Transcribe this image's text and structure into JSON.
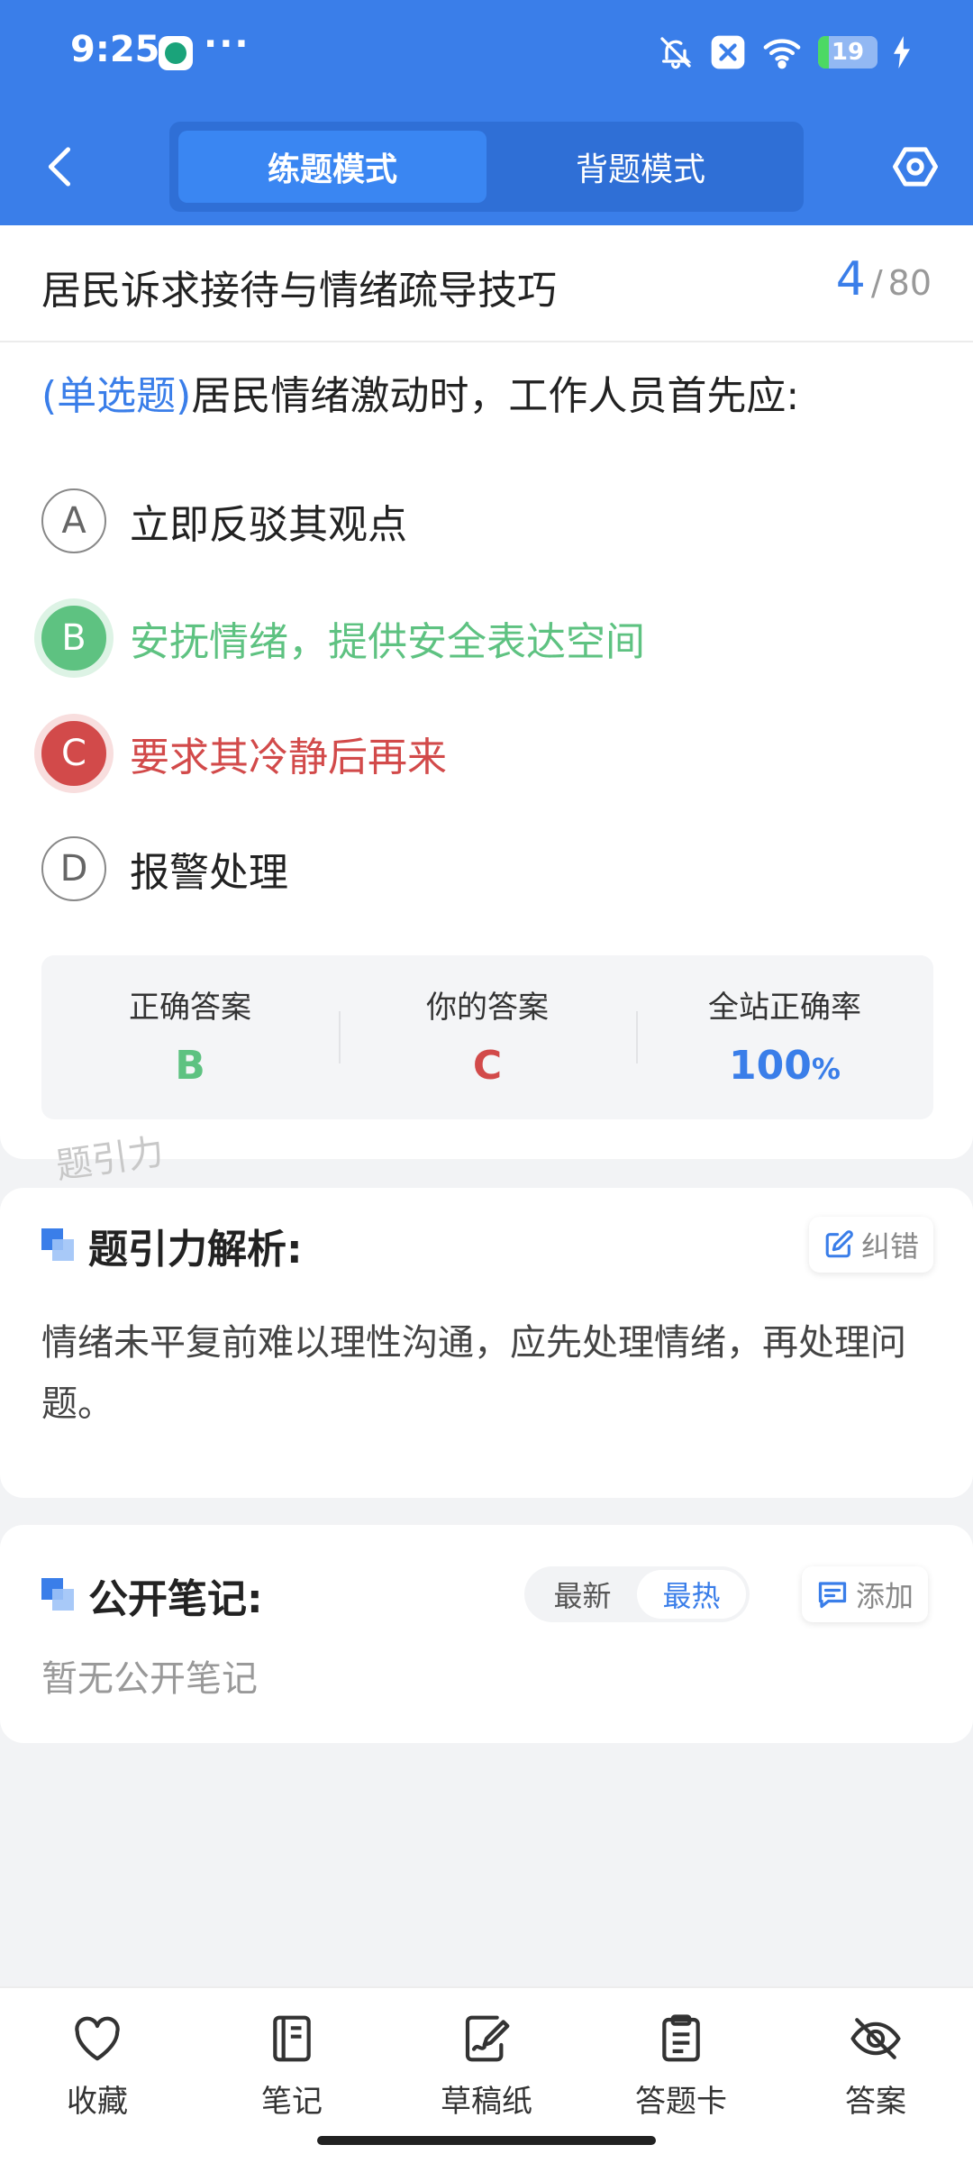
{
  "status_bar": {
    "time": "9:25",
    "more": "···",
    "battery": "19"
  },
  "nav": {
    "modes": [
      {
        "label": "练题模式",
        "active": true
      },
      {
        "label": "背题模式",
        "active": false
      }
    ]
  },
  "chapter": {
    "title": "居民诉求接待与情绪疏导技巧",
    "current": "4",
    "separator": "/",
    "total": "80"
  },
  "question": {
    "type": "(单选题)",
    "stem": "居民情绪激动时，工作人员首先应:",
    "options": [
      {
        "letter": "A",
        "text": "立即反驳其观点",
        "state": "normal"
      },
      {
        "letter": "B",
        "text": "安抚情绪，提供安全表达空间",
        "state": "correct"
      },
      {
        "letter": "C",
        "text": "要求其冷静后再来",
        "state": "wrong"
      },
      {
        "letter": "D",
        "text": "报警处理",
        "state": "normal"
      }
    ]
  },
  "result": {
    "correct_label": "正确答案",
    "correct_value": "B",
    "yours_label": "你的答案",
    "yours_value": "C",
    "rate_label": "全站正确率",
    "rate_value": "100",
    "rate_unit": "%"
  },
  "watermark": "题引力",
  "analysis": {
    "title": "题引力解析:",
    "report_label": "纠错",
    "text": "情绪未平复前难以理性沟通，应先处理情绪，再处理问题。"
  },
  "notes": {
    "title": "公开笔记:",
    "sort_options": [
      {
        "label": "最新",
        "active": false
      },
      {
        "label": "最热",
        "active": true
      }
    ],
    "add_label": "添加",
    "empty_text": "暂无公开笔记"
  },
  "bottom_tabs": [
    {
      "label": "收藏",
      "icon": "heart-icon"
    },
    {
      "label": "笔记",
      "icon": "notebook-icon"
    },
    {
      "label": "草稿纸",
      "icon": "draft-icon"
    },
    {
      "label": "答题卡",
      "icon": "answer-sheet-icon"
    },
    {
      "label": "答案",
      "icon": "eye-off-icon"
    }
  ],
  "colors": {
    "primary": "#3a7ee9",
    "correct": "#5ec281",
    "wrong": "#d24a4a"
  }
}
